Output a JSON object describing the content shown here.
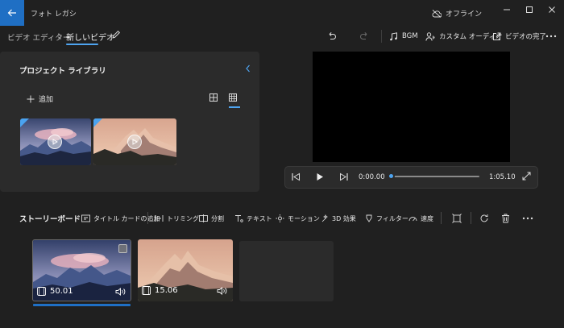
{
  "app": {
    "title": "フォト レガシ",
    "offline_label": "オフライン"
  },
  "header": {
    "breadcrumb_root": "ビデオ エディター",
    "breadcrumb_current": "新しいビデオ",
    "toolbar": {
      "bgm_label": "BGM",
      "custom_audio_label": "カスタム オーディオ",
      "finish_label": "ビデオの完了"
    }
  },
  "library": {
    "title": "プロジェクト ライブラリ",
    "add_label": "追加"
  },
  "player": {
    "current_time": "0:00.00",
    "total_time": "1:05.10",
    "progress": 0.0
  },
  "storyboard": {
    "title": "ストーリーボード",
    "tools": [
      "タイトル カードの追加",
      "トリミング",
      "分割",
      "テキスト",
      "モーション",
      "3D 効果",
      "フィルター",
      "速度"
    ],
    "clips": [
      {
        "duration": "50.01"
      },
      {
        "duration": "15.06"
      }
    ]
  },
  "colors": {
    "accent": "#1f6fc4",
    "accent_light": "#4ea4f0",
    "background": "#202020",
    "panel": "#2b2b2b"
  }
}
